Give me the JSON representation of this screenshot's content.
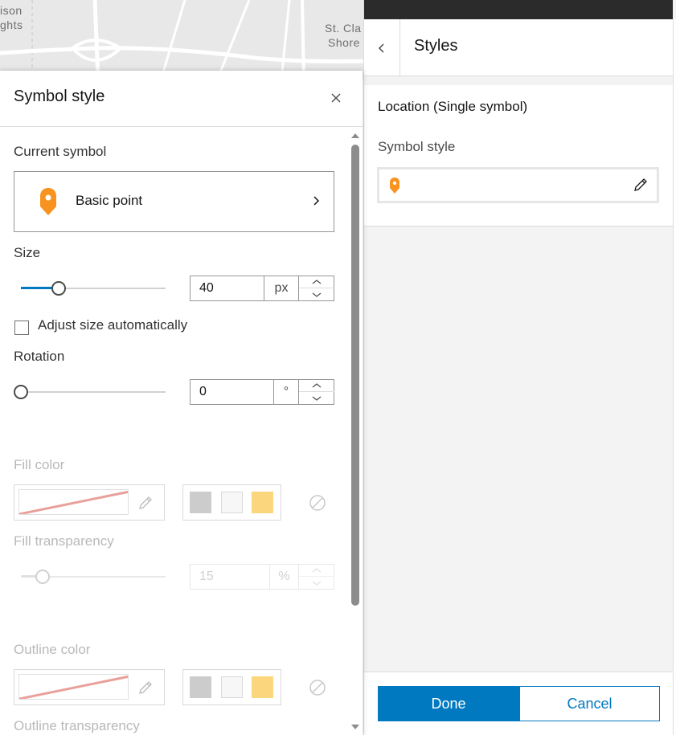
{
  "map": {
    "labels": [
      "ison",
      "ghts",
      "St. Cla",
      "Shore"
    ]
  },
  "right_panel": {
    "title": "Styles",
    "section_heading": "Location (Single symbol)",
    "symbol_style_label": "Symbol style",
    "done_label": "Done",
    "cancel_label": "Cancel",
    "accent_color": "#0079c1"
  },
  "left_panel": {
    "title": "Symbol style",
    "current_symbol": {
      "label": "Current symbol",
      "name": "Basic point",
      "icon": "map-pin-icon",
      "color": "#f7931e"
    },
    "size": {
      "label": "Size",
      "value": "40",
      "unit": "px",
      "slider_fraction": 0.26
    },
    "adjust_size": {
      "label": "Adjust size automatically",
      "checked": false
    },
    "rotation": {
      "label": "Rotation",
      "value": "0",
      "unit": "°",
      "slider_fraction": 0.0
    },
    "fill_color": {
      "label": "Fill color",
      "presets": [
        "#cccccc",
        "#f7f7f7",
        "#fcd67c"
      ]
    },
    "fill_transparency": {
      "label": "Fill transparency",
      "value": "15",
      "unit": "%",
      "slider_fraction": 0.15
    },
    "outline_color": {
      "label": "Outline color",
      "presets": [
        "#cccccc",
        "#f7f7f7",
        "#fcd67c"
      ]
    },
    "outline_transparency": {
      "label": "Outline transparency"
    }
  }
}
